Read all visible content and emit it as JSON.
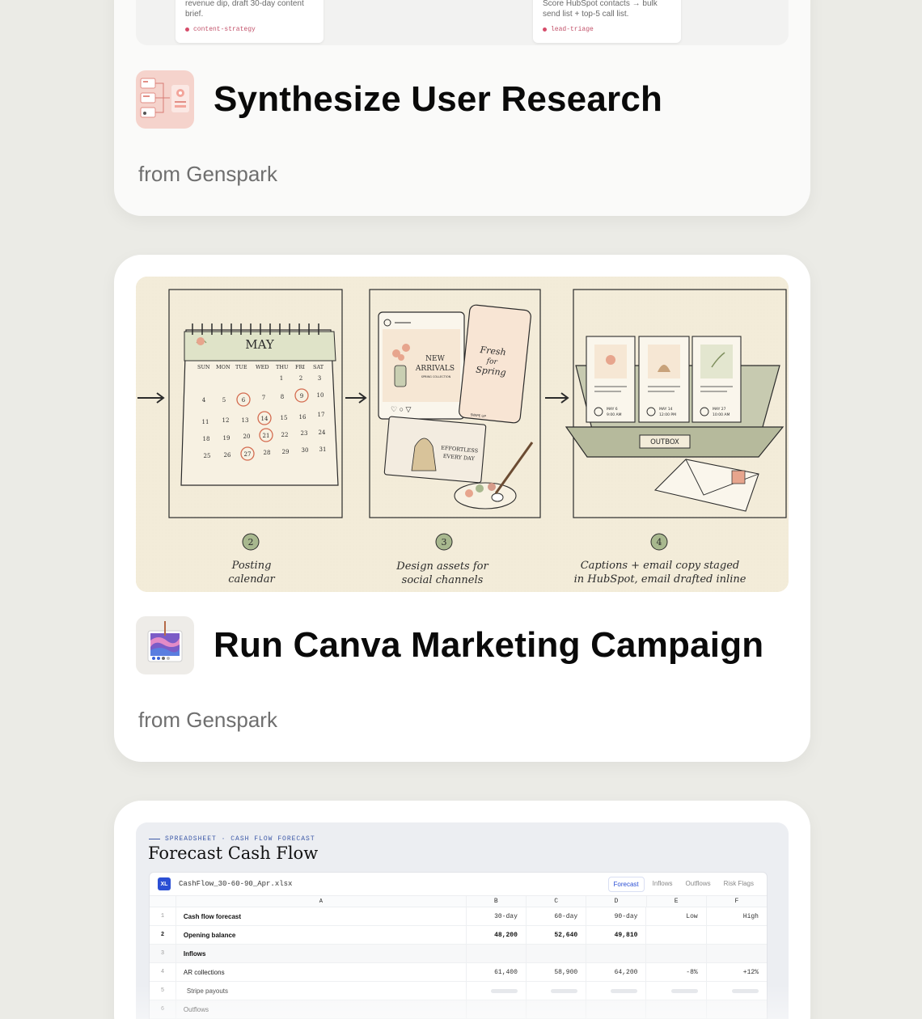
{
  "cards": [
    {
      "title": "Synthesize User Research",
      "source": "from Genspark",
      "preview": {
        "left_card": {
          "text": "revenue dip, draft 30-day content brief.",
          "tag": "content-strategy"
        },
        "right_card": {
          "text": "Score HubSpot contacts → bulk send list + top-5 call list.",
          "tag": "lead-triage"
        }
      }
    },
    {
      "title": "Run Canva Marketing Campaign",
      "source": "from Genspark",
      "illustration": {
        "calendar_month": "MAY",
        "weekdays": [
          "SUN",
          "MON",
          "TUE",
          "WED",
          "THU",
          "FRI",
          "SAT"
        ],
        "circled_days": [
          6,
          9,
          14,
          21,
          27
        ],
        "post1_text": "NEW ARRIVALS",
        "post1_sub": "SPRING COLLECTION",
        "post2_text": "Fresh for Spring",
        "post2_sub": "SWIPE UP",
        "post3_text": "EFFORTLESS EVERY DAY",
        "outbox_label": "OUTBOX",
        "scheduled": [
          {
            "date": "MAY 6",
            "time": "9:00 AM"
          },
          {
            "date": "MAY 14",
            "time": "12:00 PM"
          },
          {
            "date": "MAY 27",
            "time": "10:00 AM"
          }
        ],
        "steps": [
          {
            "num": "2",
            "line1": "Posting",
            "line2": "calendar"
          },
          {
            "num": "3",
            "line1": "Design assets for",
            "line2": "social channels"
          },
          {
            "num": "4",
            "line1": "Captions + email copy staged",
            "line2": "in HubSpot, email drafted inline"
          }
        ]
      }
    },
    {
      "preview": {
        "eyebrow": "SPREADSHEET · CASH FLOW FORECAST",
        "heading": "Forecast Cash Flow",
        "badge": "XL",
        "filename": "CashFlow_30-60-90_Apr.xlsx",
        "tabs": [
          "Forecast",
          "Inflows",
          "Outflows",
          "Risk Flags"
        ],
        "columns": [
          "A",
          "B",
          "C",
          "D",
          "E",
          "F"
        ],
        "rows": [
          {
            "idx": "1",
            "label": "Cash flow forecast",
            "values": [
              "30-day",
              "60-day",
              "90-day",
              "Low",
              "High"
            ]
          },
          {
            "idx": "2",
            "label": "Opening balance",
            "values": [
              "48,200",
              "52,640",
              "49,810",
              "",
              ""
            ]
          },
          {
            "idx": "3",
            "label": "Inflows",
            "values": [
              "",
              "",
              "",
              "",
              ""
            ]
          },
          {
            "idx": "4",
            "label": "AR collections",
            "values": [
              "61,400",
              "58,900",
              "64,200",
              "-8%",
              "+12%"
            ]
          },
          {
            "idx": "5",
            "label": "Stripe payouts",
            "values": [
              "",
              "",
              "",
              "",
              ""
            ]
          },
          {
            "idx": "6",
            "label": "Outflows",
            "values": [
              "",
              "",
              "",
              "",
              ""
            ]
          }
        ]
      }
    }
  ]
}
